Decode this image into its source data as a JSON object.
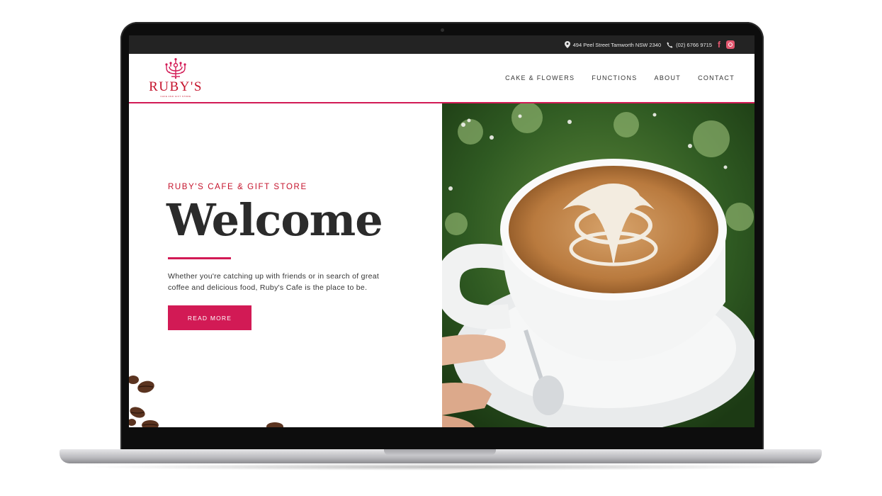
{
  "topbar": {
    "address": "494 Peel Street Tamworth NSW 2340",
    "phone": "(02) 6766 9715",
    "social": [
      "facebook-icon",
      "instagram-icon"
    ]
  },
  "brand": {
    "name": "RUBY'S",
    "tagline": "CAFE AND GIFT STORE"
  },
  "nav": {
    "items": [
      {
        "label": "CAKE & FLOWERS"
      },
      {
        "label": "FUNCTIONS"
      },
      {
        "label": "ABOUT"
      },
      {
        "label": "CONTACT"
      }
    ]
  },
  "hero": {
    "kicker": "RUBY'S CAFE & GIFT STORE",
    "title": "Welcome",
    "description": "Whether you're catching up with friends or in search of great coffee and delicious food, Ruby's Cafe is the place to be.",
    "button_label": "READ MORE"
  },
  "colors": {
    "accent": "#d21a55",
    "brand_red": "#c5132c",
    "topbar_bg": "#232323",
    "text_dark": "#2b2b2b"
  }
}
